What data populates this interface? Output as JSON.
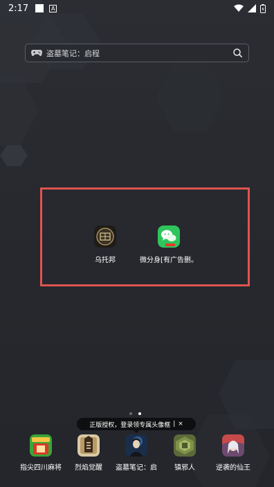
{
  "status_bar": {
    "time": "2:17",
    "a_badge": "A"
  },
  "search": {
    "label": "盗墓笔记：启程"
  },
  "folder": {
    "apps": [
      {
        "label": "乌托邦",
        "icon": "utopia-app-icon"
      },
      {
        "label": "微分身[有广告删。",
        "icon": "wechat-clone-app-icon"
      }
    ]
  },
  "page_indicator": {
    "pages": 2,
    "active": 2
  },
  "tooltip": {
    "text": "正版授权，登录领专属头像框",
    "separator": "|",
    "close": "×"
  },
  "dock": {
    "items": [
      {
        "label": "指尖四川麻将",
        "icon": "sichuan-mahjong-icon"
      },
      {
        "label": "烈焰觉醒",
        "icon": "flame-awakening-icon"
      },
      {
        "label": "盗墓笔记：启",
        "icon": "tomb-notes-icon"
      },
      {
        "label": "镇邪人",
        "icon": "zhenxieren-icon"
      },
      {
        "label": "逆袭的仙王",
        "icon": "immortal-king-icon"
      }
    ]
  },
  "colors": {
    "highlight": "#e0544f",
    "background": "#2b2d33",
    "wechat_green": "#2fc45c"
  }
}
